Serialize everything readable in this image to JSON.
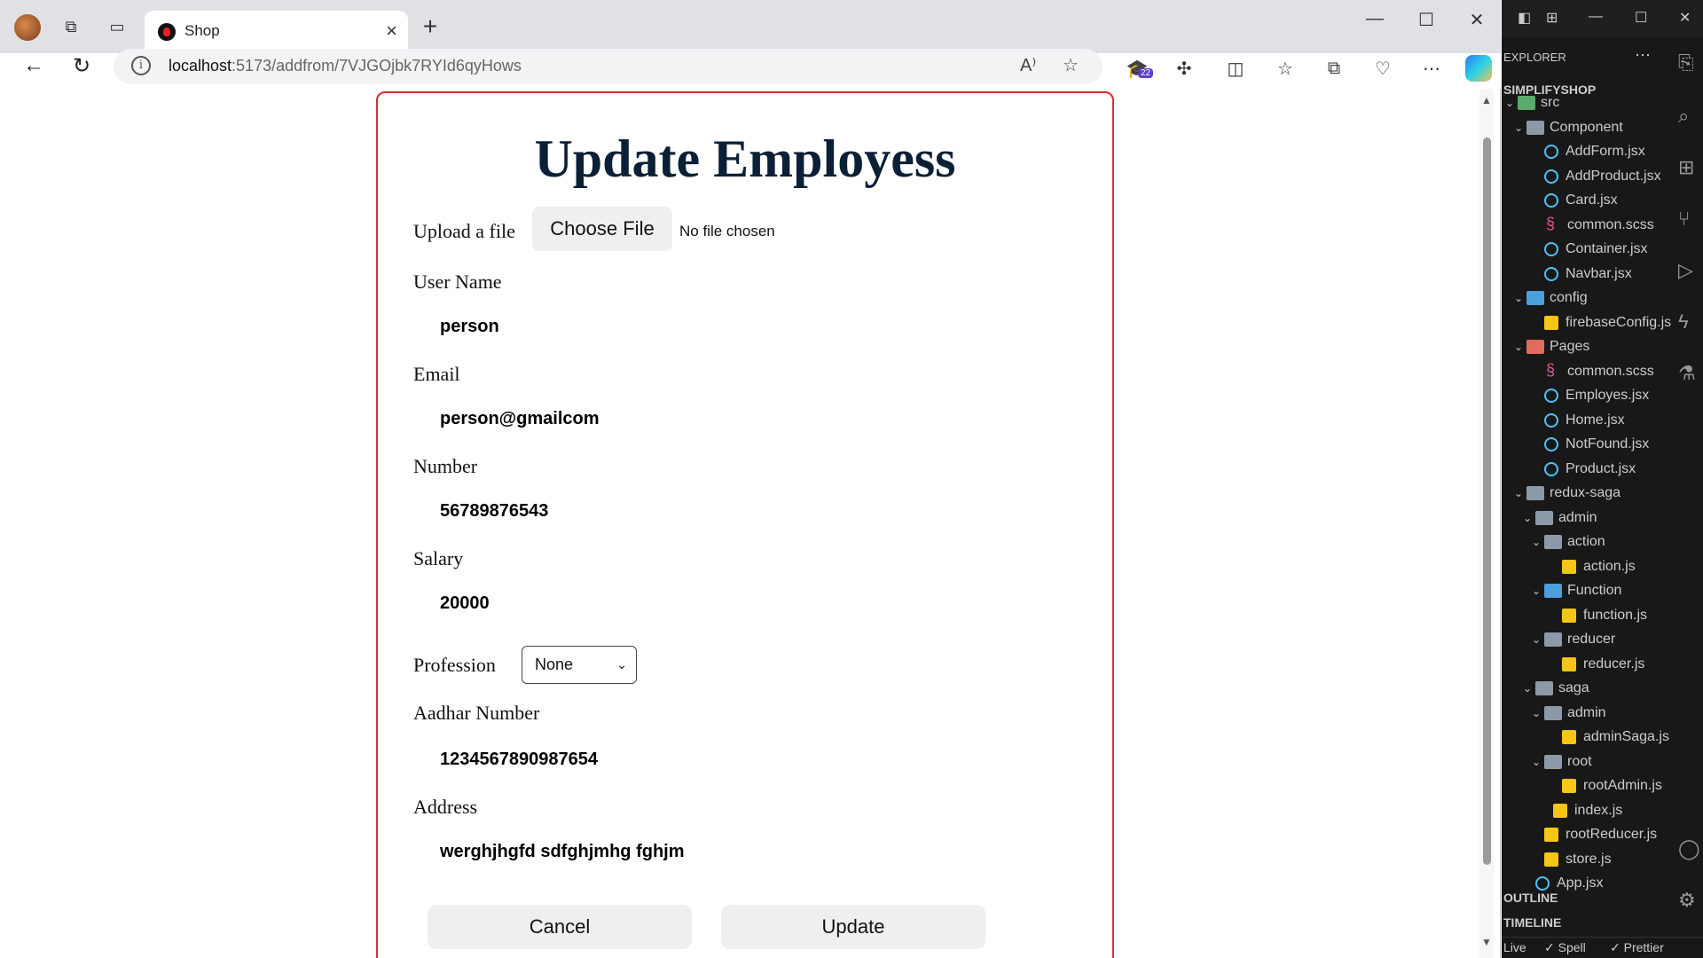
{
  "browser": {
    "tab_title": "Shop",
    "url_host": "localhost",
    "url_rest": ":5173/addfrom/7VJGOjbk7RYId6qyHows",
    "extension_badge": "22"
  },
  "form": {
    "title": "Update Employess",
    "upload_label": "Upload a file",
    "choose_file": "Choose File",
    "no_file": "No file chosen",
    "username_label": "User Name",
    "username_value": "person",
    "email_label": "Email",
    "email_value": "person@gmailcom",
    "number_label": "Number",
    "number_value": "56789876543",
    "salary_label": "Salary",
    "salary_value": "20000",
    "profession_label": "Profession",
    "profession_value": "None",
    "aadhar_label": "Aadhar Number",
    "aadhar_value": "1234567890987654",
    "address_label": "Address",
    "address_value": "werghjhgfd sdfghjmhg fghjm",
    "cancel": "Cancel",
    "update": "Update"
  },
  "vscode": {
    "explorer": "EXPLORER",
    "project": "SIMPLIFYSHOP",
    "tree": [
      {
        "label": "src",
        "icon": "folder-g",
        "chev": "v"
      },
      {
        "label": "Component",
        "icon": "folder",
        "chev": "v"
      },
      {
        "label": "AddForm.jsx",
        "icon": "react",
        "chev": ""
      },
      {
        "label": "AddProduct.jsx",
        "icon": "react",
        "chev": ""
      },
      {
        "label": "Card.jsx",
        "icon": "react",
        "chev": ""
      },
      {
        "label": "common.scss",
        "icon": "scss",
        "chev": ""
      },
      {
        "label": "Container.jsx",
        "icon": "react",
        "chev": ""
      },
      {
        "label": "Navbar.jsx",
        "icon": "react",
        "chev": ""
      },
      {
        "label": "config",
        "icon": "folder-b",
        "chev": "v"
      },
      {
        "label": "firebaseConfig.js",
        "icon": "js",
        "chev": ""
      },
      {
        "label": "Pages",
        "icon": "folder-r",
        "chev": "v"
      },
      {
        "label": "common.scss",
        "icon": "scss",
        "chev": ""
      },
      {
        "label": "Employes.jsx",
        "icon": "react",
        "chev": ""
      },
      {
        "label": "Home.jsx",
        "icon": "react",
        "chev": ""
      },
      {
        "label": "NotFound.jsx",
        "icon": "react",
        "chev": ""
      },
      {
        "label": "Product.jsx",
        "icon": "react",
        "chev": ""
      },
      {
        "label": "redux-saga",
        "icon": "folder",
        "chev": "v"
      },
      {
        "label": "admin",
        "icon": "folder",
        "chev": "v"
      },
      {
        "label": "action",
        "icon": "folder",
        "chev": "v"
      },
      {
        "label": "action.js",
        "icon": "js",
        "chev": ""
      },
      {
        "label": "Function",
        "icon": "folder-b",
        "chev": "v"
      },
      {
        "label": "function.js",
        "icon": "js",
        "chev": ""
      },
      {
        "label": "reducer",
        "icon": "folder",
        "chev": "v"
      },
      {
        "label": "reducer.js",
        "icon": "js",
        "chev": ""
      },
      {
        "label": "saga",
        "icon": "folder",
        "chev": "v"
      },
      {
        "label": "admin",
        "icon": "folder",
        "chev": "v"
      },
      {
        "label": "adminSaga.js",
        "icon": "js",
        "chev": ""
      },
      {
        "label": "root",
        "icon": "folder",
        "chev": "v"
      },
      {
        "label": "rootAdmin.js",
        "icon": "js",
        "chev": ""
      },
      {
        "label": "index.js",
        "icon": "js",
        "chev": ""
      },
      {
        "label": "rootReducer.js",
        "icon": "js",
        "chev": ""
      },
      {
        "label": "store.js",
        "icon": "js",
        "chev": ""
      },
      {
        "label": "App.jsx",
        "icon": "react",
        "chev": ""
      }
    ],
    "outline": "OUTLINE",
    "timeline": "TIMELINE",
    "status_live": "Live",
    "status_spell": "✓ Spell",
    "status_prettier": "✓ Prettier"
  }
}
